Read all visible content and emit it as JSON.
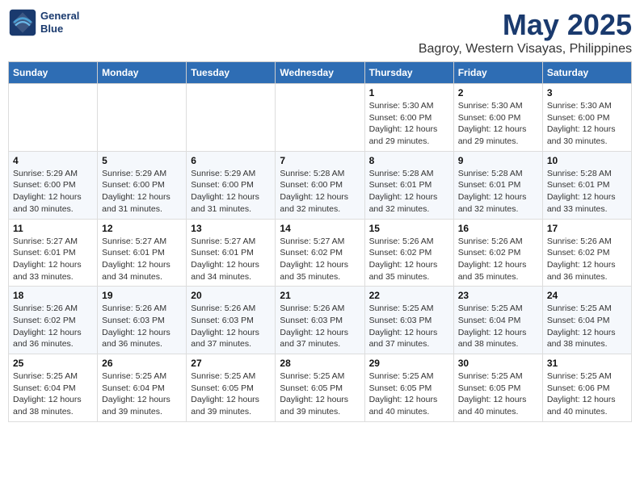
{
  "logo": {
    "line1": "General",
    "line2": "Blue"
  },
  "title": "May 2025",
  "subtitle": "Bagroy, Western Visayas, Philippines",
  "days_of_week": [
    "Sunday",
    "Monday",
    "Tuesday",
    "Wednesday",
    "Thursday",
    "Friday",
    "Saturday"
  ],
  "weeks": [
    [
      {
        "day": "",
        "info": ""
      },
      {
        "day": "",
        "info": ""
      },
      {
        "day": "",
        "info": ""
      },
      {
        "day": "",
        "info": ""
      },
      {
        "day": "1",
        "info": "Sunrise: 5:30 AM\nSunset: 6:00 PM\nDaylight: 12 hours\nand 29 minutes."
      },
      {
        "day": "2",
        "info": "Sunrise: 5:30 AM\nSunset: 6:00 PM\nDaylight: 12 hours\nand 29 minutes."
      },
      {
        "day": "3",
        "info": "Sunrise: 5:30 AM\nSunset: 6:00 PM\nDaylight: 12 hours\nand 30 minutes."
      }
    ],
    [
      {
        "day": "4",
        "info": "Sunrise: 5:29 AM\nSunset: 6:00 PM\nDaylight: 12 hours\nand 30 minutes."
      },
      {
        "day": "5",
        "info": "Sunrise: 5:29 AM\nSunset: 6:00 PM\nDaylight: 12 hours\nand 31 minutes."
      },
      {
        "day": "6",
        "info": "Sunrise: 5:29 AM\nSunset: 6:00 PM\nDaylight: 12 hours\nand 31 minutes."
      },
      {
        "day": "7",
        "info": "Sunrise: 5:28 AM\nSunset: 6:00 PM\nDaylight: 12 hours\nand 32 minutes."
      },
      {
        "day": "8",
        "info": "Sunrise: 5:28 AM\nSunset: 6:01 PM\nDaylight: 12 hours\nand 32 minutes."
      },
      {
        "day": "9",
        "info": "Sunrise: 5:28 AM\nSunset: 6:01 PM\nDaylight: 12 hours\nand 32 minutes."
      },
      {
        "day": "10",
        "info": "Sunrise: 5:28 AM\nSunset: 6:01 PM\nDaylight: 12 hours\nand 33 minutes."
      }
    ],
    [
      {
        "day": "11",
        "info": "Sunrise: 5:27 AM\nSunset: 6:01 PM\nDaylight: 12 hours\nand 33 minutes."
      },
      {
        "day": "12",
        "info": "Sunrise: 5:27 AM\nSunset: 6:01 PM\nDaylight: 12 hours\nand 34 minutes."
      },
      {
        "day": "13",
        "info": "Sunrise: 5:27 AM\nSunset: 6:01 PM\nDaylight: 12 hours\nand 34 minutes."
      },
      {
        "day": "14",
        "info": "Sunrise: 5:27 AM\nSunset: 6:02 PM\nDaylight: 12 hours\nand 35 minutes."
      },
      {
        "day": "15",
        "info": "Sunrise: 5:26 AM\nSunset: 6:02 PM\nDaylight: 12 hours\nand 35 minutes."
      },
      {
        "day": "16",
        "info": "Sunrise: 5:26 AM\nSunset: 6:02 PM\nDaylight: 12 hours\nand 35 minutes."
      },
      {
        "day": "17",
        "info": "Sunrise: 5:26 AM\nSunset: 6:02 PM\nDaylight: 12 hours\nand 36 minutes."
      }
    ],
    [
      {
        "day": "18",
        "info": "Sunrise: 5:26 AM\nSunset: 6:02 PM\nDaylight: 12 hours\nand 36 minutes."
      },
      {
        "day": "19",
        "info": "Sunrise: 5:26 AM\nSunset: 6:03 PM\nDaylight: 12 hours\nand 36 minutes."
      },
      {
        "day": "20",
        "info": "Sunrise: 5:26 AM\nSunset: 6:03 PM\nDaylight: 12 hours\nand 37 minutes."
      },
      {
        "day": "21",
        "info": "Sunrise: 5:26 AM\nSunset: 6:03 PM\nDaylight: 12 hours\nand 37 minutes."
      },
      {
        "day": "22",
        "info": "Sunrise: 5:25 AM\nSunset: 6:03 PM\nDaylight: 12 hours\nand 37 minutes."
      },
      {
        "day": "23",
        "info": "Sunrise: 5:25 AM\nSunset: 6:04 PM\nDaylight: 12 hours\nand 38 minutes."
      },
      {
        "day": "24",
        "info": "Sunrise: 5:25 AM\nSunset: 6:04 PM\nDaylight: 12 hours\nand 38 minutes."
      }
    ],
    [
      {
        "day": "25",
        "info": "Sunrise: 5:25 AM\nSunset: 6:04 PM\nDaylight: 12 hours\nand 38 minutes."
      },
      {
        "day": "26",
        "info": "Sunrise: 5:25 AM\nSunset: 6:04 PM\nDaylight: 12 hours\nand 39 minutes."
      },
      {
        "day": "27",
        "info": "Sunrise: 5:25 AM\nSunset: 6:05 PM\nDaylight: 12 hours\nand 39 minutes."
      },
      {
        "day": "28",
        "info": "Sunrise: 5:25 AM\nSunset: 6:05 PM\nDaylight: 12 hours\nand 39 minutes."
      },
      {
        "day": "29",
        "info": "Sunrise: 5:25 AM\nSunset: 6:05 PM\nDaylight: 12 hours\nand 40 minutes."
      },
      {
        "day": "30",
        "info": "Sunrise: 5:25 AM\nSunset: 6:05 PM\nDaylight: 12 hours\nand 40 minutes."
      },
      {
        "day": "31",
        "info": "Sunrise: 5:25 AM\nSunset: 6:06 PM\nDaylight: 12 hours\nand 40 minutes."
      }
    ]
  ]
}
